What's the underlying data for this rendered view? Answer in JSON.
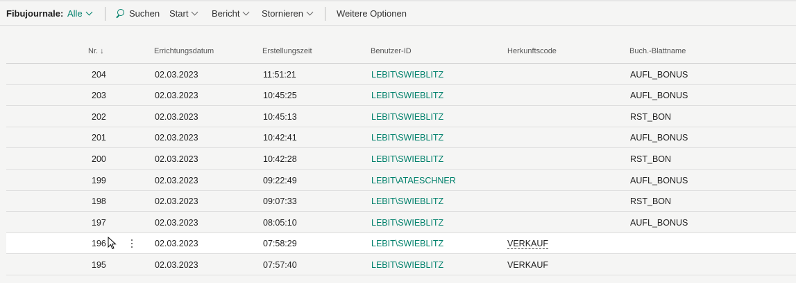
{
  "toolbar": {
    "title": "Fibujournale:",
    "filter": "Alle",
    "search": "Suchen",
    "start": "Start",
    "report": "Bericht",
    "cancel": "Stornieren",
    "more": "Weitere Optionen"
  },
  "columns": {
    "nr": "Nr. ↓",
    "date": "Errichtungsdatum",
    "time": "Erstellungszeit",
    "user": "Benutzer-ID",
    "source": "Herkunftscode",
    "batch": "Buch.-Blattname"
  },
  "rows": [
    {
      "nr": "204",
      "date": "02.03.2023",
      "time": "11:51:21",
      "user": "LEBIT\\SWIEBLITZ",
      "source": "",
      "batch": "AUFL_BONUS"
    },
    {
      "nr": "203",
      "date": "02.03.2023",
      "time": "10:45:25",
      "user": "LEBIT\\SWIEBLITZ",
      "source": "",
      "batch": "AUFL_BONUS"
    },
    {
      "nr": "202",
      "date": "02.03.2023",
      "time": "10:45:13",
      "user": "LEBIT\\SWIEBLITZ",
      "source": "",
      "batch": "RST_BON"
    },
    {
      "nr": "201",
      "date": "02.03.2023",
      "time": "10:42:41",
      "user": "LEBIT\\SWIEBLITZ",
      "source": "",
      "batch": "AUFL_BONUS"
    },
    {
      "nr": "200",
      "date": "02.03.2023",
      "time": "10:42:28",
      "user": "LEBIT\\SWIEBLITZ",
      "source": "",
      "batch": "RST_BON"
    },
    {
      "nr": "199",
      "date": "02.03.2023",
      "time": "09:22:49",
      "user": "LEBIT\\ATAESCHNER",
      "source": "",
      "batch": "AUFL_BONUS"
    },
    {
      "nr": "198",
      "date": "02.03.2023",
      "time": "09:07:33",
      "user": "LEBIT\\SWIEBLITZ",
      "source": "",
      "batch": "RST_BON"
    },
    {
      "nr": "197",
      "date": "02.03.2023",
      "time": "08:05:10",
      "user": "LEBIT\\SWIEBLITZ",
      "source": "",
      "batch": "AUFL_BONUS"
    },
    {
      "nr": "196",
      "date": "02.03.2023",
      "time": "07:58:29",
      "user": "LEBIT\\SWIEBLITZ",
      "source": "VERKAUF",
      "batch": ""
    },
    {
      "nr": "195",
      "date": "02.03.2023",
      "time": "07:57:40",
      "user": "LEBIT\\SWIEBLITZ",
      "source": "VERKAUF",
      "batch": ""
    }
  ],
  "colors": {
    "accent": "#00806b",
    "background": "#f5f5f4",
    "selected_row": "#ffffff"
  },
  "selected_row_index": 8
}
